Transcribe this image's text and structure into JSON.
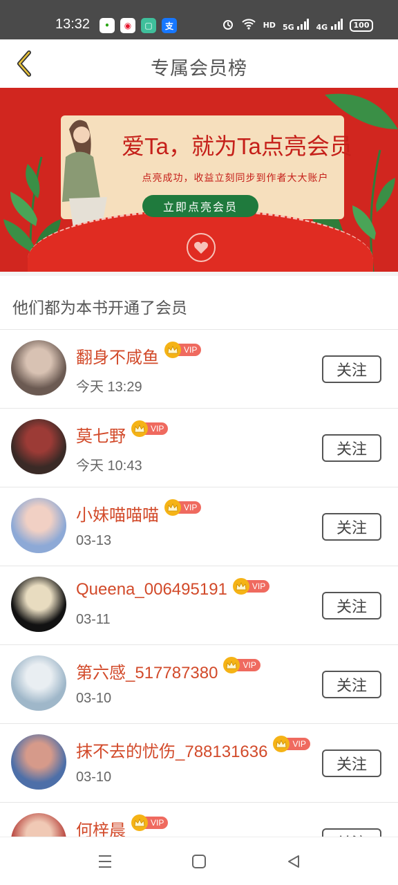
{
  "status_bar": {
    "time": "13:32",
    "app_icons": [
      {
        "name": "wechat-icon",
        "glyph": "•",
        "bg": "#ffffff",
        "fg": "#2aa515"
      },
      {
        "name": "weibo-icon",
        "glyph": "◉",
        "bg": "#ffffff",
        "fg": "#e6162d"
      },
      {
        "name": "notes-icon",
        "glyph": "▢",
        "bg": "#3fbf9b",
        "fg": "#ffffff"
      },
      {
        "name": "alipay-icon",
        "glyph": "支",
        "bg": "#1677ff",
        "fg": "#ffffff"
      }
    ],
    "network_labels": {
      "hd": "HD",
      "g5": "5G",
      "g4": "4G"
    },
    "battery": "100"
  },
  "header": {
    "title": "专属会员榜"
  },
  "banner": {
    "heading": "爱Ta，就为Ta点亮会员",
    "subtext": "点亮成功，收益立刻同步到作者大大账户",
    "button_label": "立即点亮会员"
  },
  "section": {
    "title": "他们都为本书开通了会员"
  },
  "vip_label": "VIP",
  "follow_label": "关注",
  "members": [
    {
      "name": "翻身不咸鱼",
      "time": "今天 13:29",
      "avatar_colors": [
        "#6b5a52",
        "#d8c2b3"
      ]
    },
    {
      "name": "莫七野",
      "time": "今天 10:43",
      "avatar_colors": [
        "#3a2a26",
        "#9c3b36"
      ]
    },
    {
      "name": "小妹喵喵喵",
      "time": "03-13",
      "avatar_colors": [
        "#8da9d6",
        "#f1d0c4"
      ]
    },
    {
      "name": "Queena_006495191",
      "time": "03-11",
      "avatar_colors": [
        "#121212",
        "#e8dcc0"
      ]
    },
    {
      "name": "第六感_517787380",
      "time": "03-10",
      "avatar_colors": [
        "#9fb7c9",
        "#e9eef2"
      ]
    },
    {
      "name": "抹不去的忧伤_788131636",
      "time": "03-10",
      "avatar_colors": [
        "#4d6fa8",
        "#d69a8a"
      ]
    },
    {
      "name": "何梓晨",
      "time": "",
      "avatar_colors": [
        "#b8453e",
        "#f0c9b5"
      ]
    }
  ],
  "colors": {
    "accent_red": "#d24a2a",
    "banner_red": "#d1261f",
    "banner_green": "#1f7a3d",
    "vip_gold": "#f5b316",
    "vip_pink": "#ef6a5f"
  }
}
